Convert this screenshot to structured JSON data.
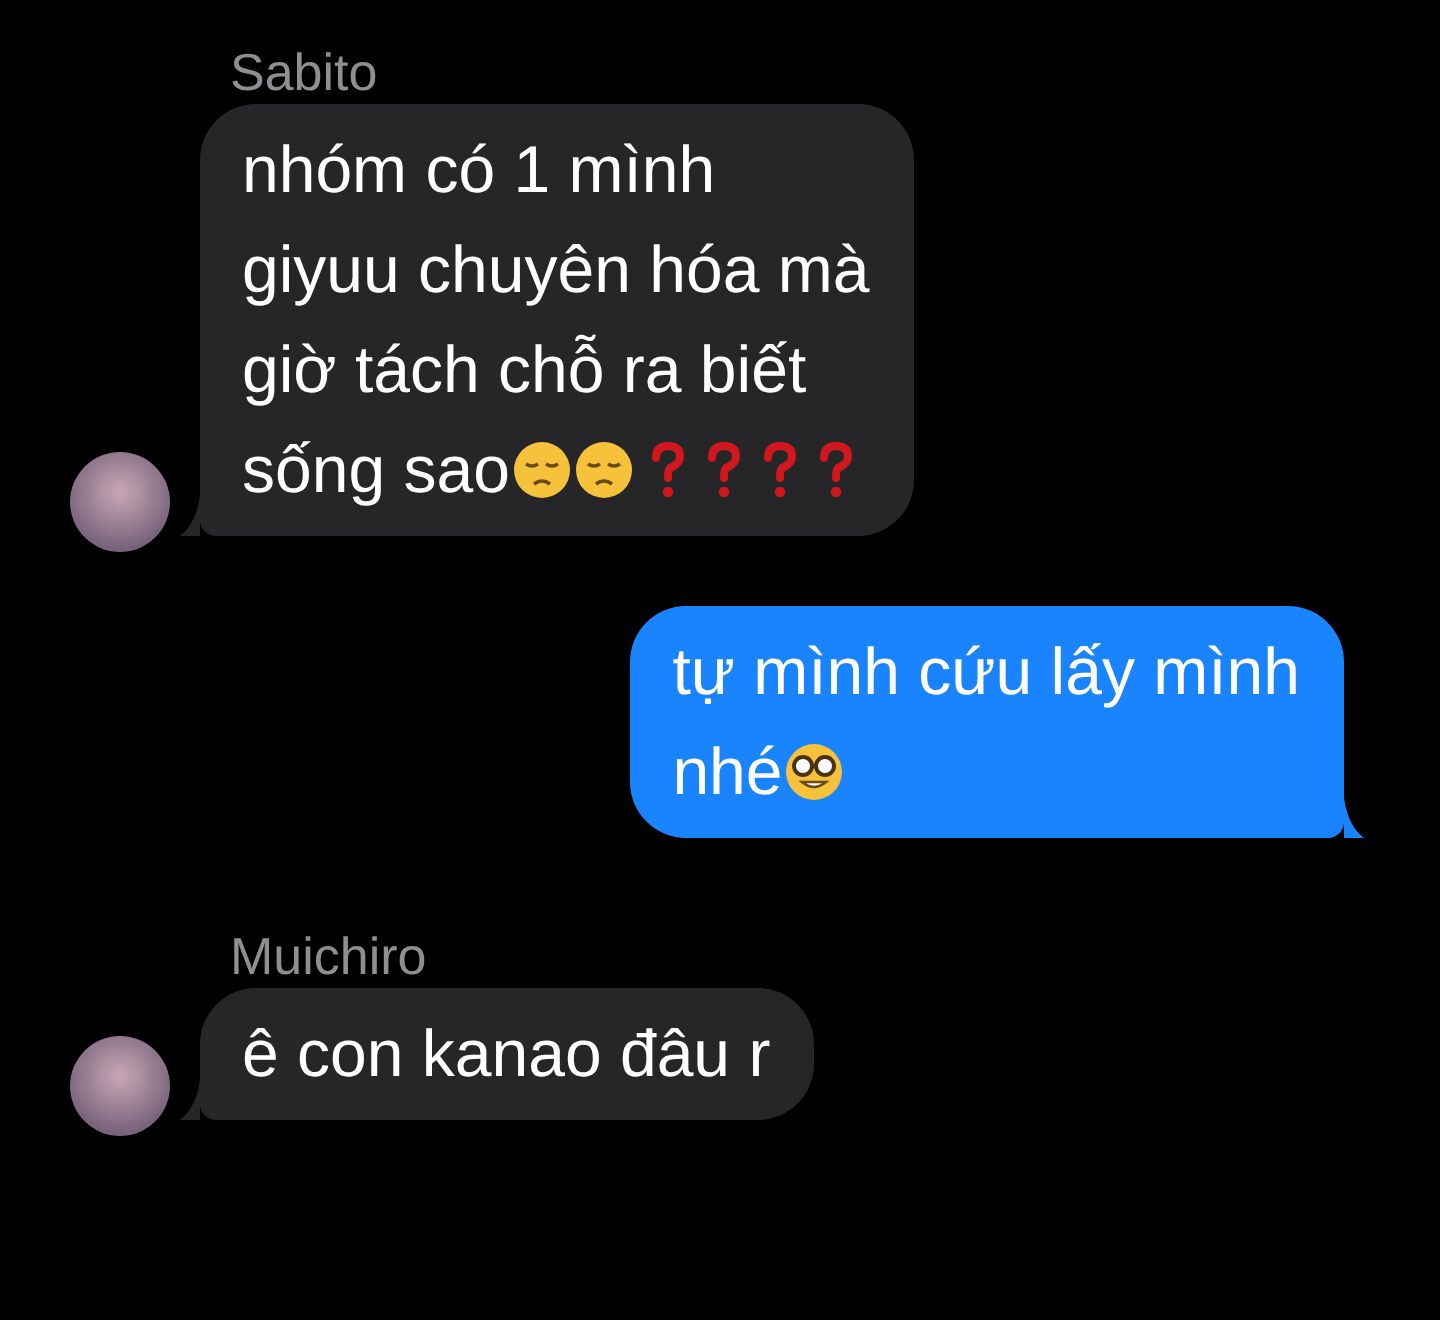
{
  "messages": [
    {
      "kind": "received",
      "sender": "Sabito",
      "segments": [
        {
          "kind": "text",
          "text": "nhóm có 1 mình\ngiyuu chuyên hóa mà\ngiờ tách chỗ ra biết"
        },
        {
          "kind": "text",
          "text": "sống sao"
        },
        {
          "kind": "pensive"
        },
        {
          "kind": "pensive"
        },
        {
          "kind": "question"
        },
        {
          "kind": "question"
        },
        {
          "kind": "question"
        },
        {
          "kind": "question"
        }
      ]
    },
    {
      "kind": "sent",
      "segments": [
        {
          "kind": "text",
          "text": "tự mình cứu lấy mình"
        },
        {
          "kind": "text",
          "text": "nhé"
        },
        {
          "kind": "nerd"
        }
      ]
    },
    {
      "kind": "received",
      "sender": "Muichiro",
      "segments": [
        {
          "kind": "text",
          "text": "ê con kanao đâu r"
        }
      ]
    }
  ]
}
